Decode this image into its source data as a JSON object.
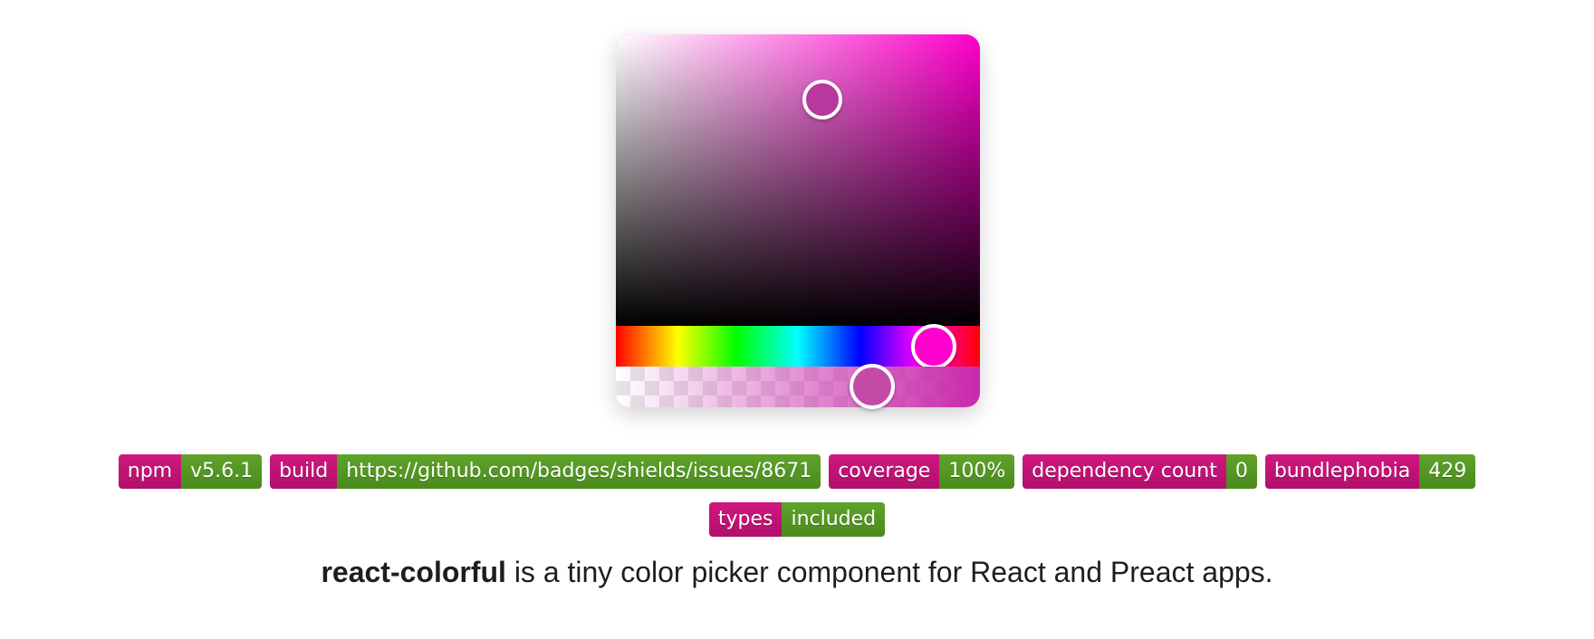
{
  "picker": {
    "hue_color": "#ff00cc",
    "selected_color": "#b8389e",
    "alpha_color": "#c44aa8"
  },
  "badges_row1": [
    {
      "label": "npm",
      "value": "v5.6.1"
    },
    {
      "label": "build",
      "value": "https://github.com/badges/shields/issues/8671"
    },
    {
      "label": "coverage",
      "value": "100%"
    },
    {
      "label": "dependency count",
      "value": "0"
    },
    {
      "label": "bundlephobia",
      "value": "429"
    }
  ],
  "badges_row2": [
    {
      "label": "types",
      "value": "included"
    }
  ],
  "badge_colors": {
    "label": "#c4127a",
    "value": "#55961f"
  },
  "description": {
    "name": "react-colorful",
    "text": " is a tiny color picker component for React and Preact apps."
  }
}
